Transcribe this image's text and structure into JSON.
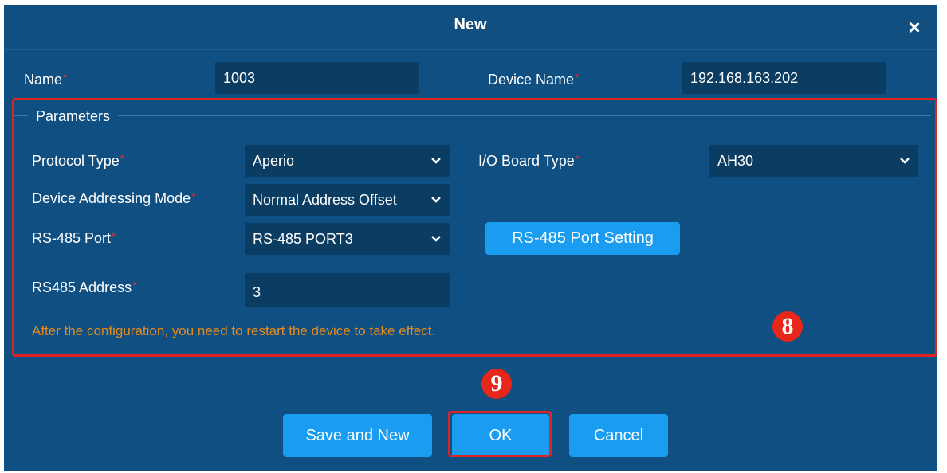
{
  "dialog": {
    "title": "New",
    "close_glyph": "×"
  },
  "fields": {
    "name_label": "Name",
    "name_value": "1003",
    "device_name_label": "Device Name",
    "device_name_value": "192.168.163.202",
    "required_mark": "*"
  },
  "parameters": {
    "legend": "Parameters",
    "protocol_type_label": "Protocol Type",
    "protocol_type_value": "Aperio",
    "io_board_type_label": "I/O Board Type",
    "io_board_type_value": "AH30",
    "addressing_mode_label": "Device Addressing Mode",
    "addressing_mode_value": "Normal Address Offset",
    "rs485_port_label": "RS-485 Port",
    "rs485_port_value": "RS-485 PORT3",
    "rs485_setting_button": "RS-485 Port Setting",
    "rs485_address_label": "RS485 Address",
    "rs485_address_value": "3",
    "note": "After the configuration, you need to restart the device to take effect."
  },
  "buttons": {
    "save_and_new": "Save and New",
    "ok": "OK",
    "cancel": "Cancel"
  },
  "annotations": {
    "marker_8": "8",
    "marker_9": "9",
    "highlight_color": "#e02424"
  },
  "icons": {
    "close": "close-icon",
    "dropdown": "chevron-down-icon"
  }
}
